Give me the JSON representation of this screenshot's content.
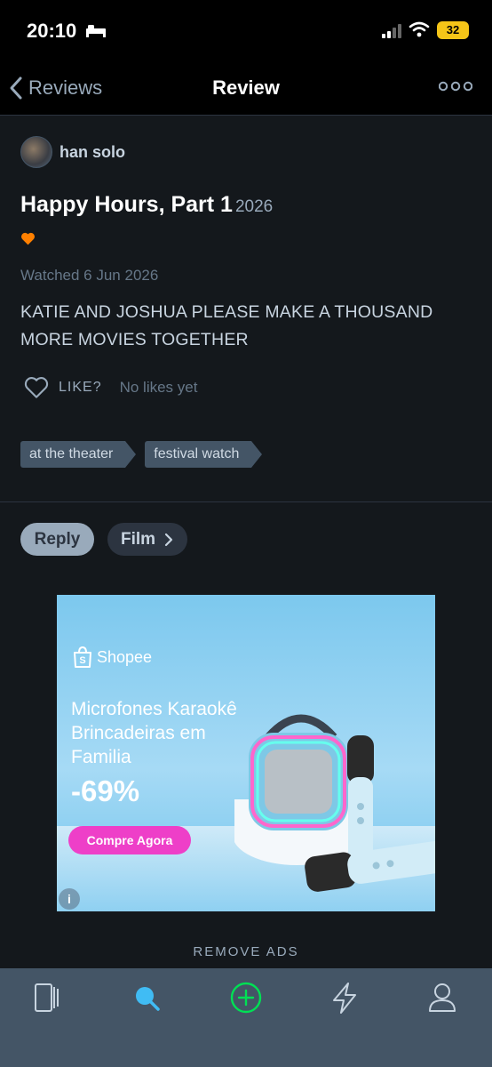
{
  "status_bar": {
    "time": "20:10",
    "battery": "32"
  },
  "nav": {
    "back_label": "Reviews",
    "title": "Review"
  },
  "review": {
    "author": "han solo",
    "film_title": "Happy Hours, Part 1",
    "film_year": "2026",
    "watched": "Watched 6 Jun 2026",
    "text": "KATIE AND JOSHUA PLEASE MAKE A THOUSAND MORE MOVIES TOGETHER",
    "like_label": "LIKE?",
    "likes_text": "No likes yet",
    "tags": [
      "at the theater",
      "festival watch"
    ]
  },
  "actions": {
    "reply": "Reply",
    "film": "Film"
  },
  "ad": {
    "brand": "Shopee",
    "headline_lines": [
      "Microfones Karaokê",
      "Brincadeiras em",
      "Familia"
    ],
    "discount": "-69%",
    "cta": "Compre Agora",
    "info": "i"
  },
  "remove_ads": "REMOVE ADS",
  "colors": {
    "accent_heart": "#ff8000",
    "tab_active": "#40bcf4",
    "add_green": "#00e054"
  },
  "tab_bar": {
    "icons": [
      "films-icon",
      "search-icon",
      "add-icon",
      "activity-icon",
      "profile-icon"
    ],
    "active": "search-icon"
  }
}
